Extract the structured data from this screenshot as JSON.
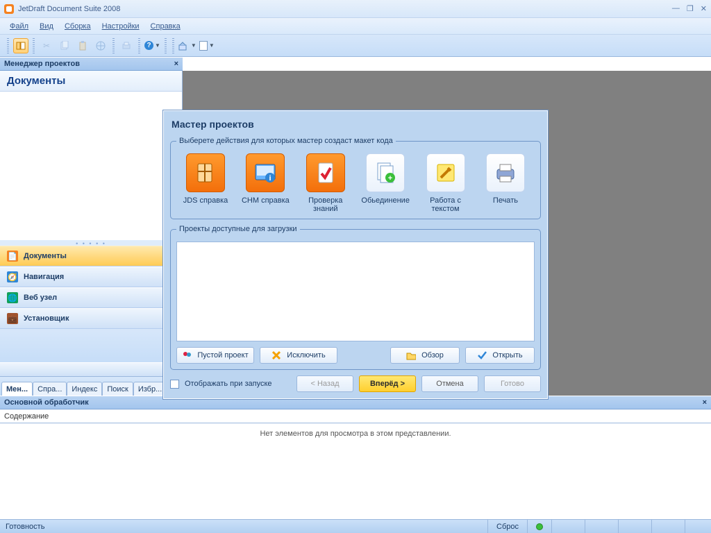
{
  "app_title": "JetDraft Document Suite 2008",
  "menu": {
    "file": "Файл",
    "view": "Вид",
    "build": "Сборка",
    "settings": "Настройки",
    "help": "Справка"
  },
  "panels": {
    "project_manager": "Менеджер проектов",
    "documents_title": "Документы",
    "main_handler": "Основной обработчик",
    "content": "Содержание",
    "preview_empty": "Нет элементов для просмотра в этом представлении."
  },
  "nav": {
    "documents": "Документы",
    "navigation": "Навигация",
    "webnode": "Веб узел",
    "installer": "Установщик"
  },
  "tabs": {
    "manager": "Мен...",
    "help": "Спра...",
    "index": "Индекс",
    "search": "Поиск",
    "fav": "Избр..."
  },
  "status": {
    "ready": "Готовность",
    "reset": "Сброс"
  },
  "dialog": {
    "title": "Мастер проектов",
    "group1": "Выберете действия для которых мастер создаст макет кода",
    "group2": "Проекты доступные для загрузки",
    "opts": {
      "jds": "JDS справка",
      "chm": "CHM справка",
      "quiz": "Проверка знаний",
      "merge": "Обьединение",
      "text": "Работа с текстом",
      "print": "Печать"
    },
    "btns": {
      "empty": "Пустой проект",
      "exclude": "Исключить",
      "browse": "Обзор",
      "open": "Открыть"
    },
    "show_on_start": "Отображать при запуске",
    "wizard": {
      "back": "< Назад",
      "next": "Вперёд >",
      "cancel": "Отмена",
      "finish": "Готово"
    }
  }
}
